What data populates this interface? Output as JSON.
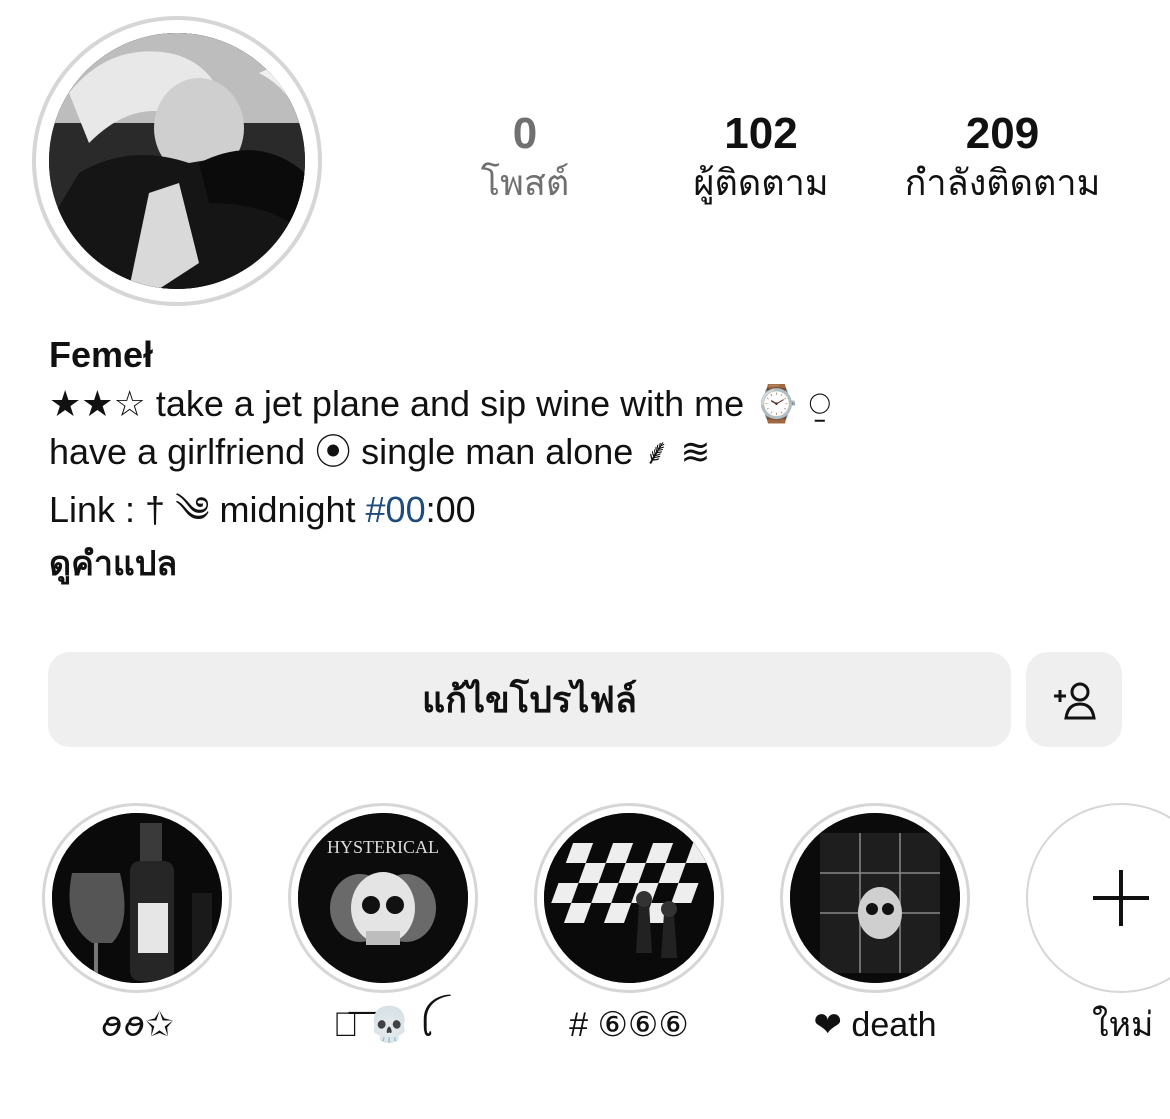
{
  "profile": {
    "avatar_icon": "profile-photo",
    "stats": {
      "posts": {
        "count": "0",
        "label": "โพสต์"
      },
      "followers": {
        "count": "102",
        "label": "ผู้ติดตาม"
      },
      "following": {
        "count": "209",
        "label": "กำลังติดตาม"
      }
    },
    "name": "Femeł",
    "bio_line_1": "★★☆ take a jet plane and sip wine with me ⌚ ⍜",
    "bio_line_2": "have a girlfriend ⦿ single man alone ⸙ ≋",
    "link_prefix": "Link : † ༄ midnight ",
    "link_hashtag": "#00",
    "link_suffix": ":00",
    "translate_label": "ดูคำแปล"
  },
  "actions": {
    "edit_profile_label": "แก้ไขโปรไฟล์",
    "add_person_icon": "add-person-icon"
  },
  "highlights": [
    {
      "label": "ꪮꪮ✩",
      "image": "wine-bottle-photo"
    },
    {
      "label": "ฑ͞ 💀 ꪶ",
      "image": "hysterical-skull-poster",
      "poster_text": "HYSTERICAL"
    },
    {
      "label": "# ⑥⑥⑥",
      "image": "chessboard-photo"
    },
    {
      "label": "❤︎ death",
      "image": "grid-skull-photo"
    },
    {
      "label": "ใหม่",
      "icon": "plus-icon"
    }
  ],
  "colors": {
    "background": "#ffffff",
    "button": "#efefef",
    "ring": "#d6d6d6",
    "hashtag": "#1d4b7a",
    "muted": "#707070"
  }
}
